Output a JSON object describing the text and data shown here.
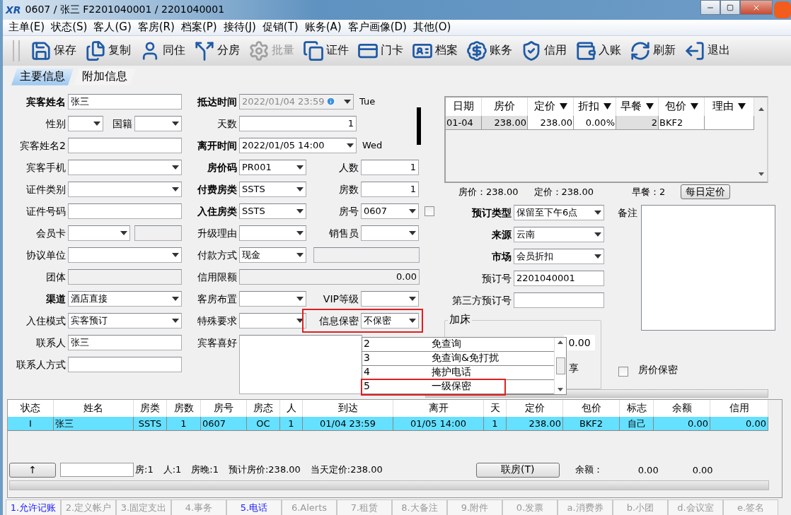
{
  "window": {
    "logo": "XR",
    "title": "0607 / 张三 F2201040001 / 2201040001"
  },
  "menu": [
    "主单(E)",
    "状态(S)",
    "客人(G)",
    "客房(R)",
    "档案(P)",
    "接待(J)",
    "促销(T)",
    "账务(A)",
    "客户画像(D)",
    "其他(O)"
  ],
  "toolbar": [
    {
      "label": "保存",
      "enabled": true
    },
    {
      "label": "复制",
      "enabled": true
    },
    {
      "label": "同住",
      "enabled": true
    },
    {
      "label": "分房",
      "enabled": true
    },
    {
      "label": "批量",
      "enabled": false
    },
    {
      "label": "证件",
      "enabled": true
    },
    {
      "label": "门卡",
      "enabled": true
    },
    {
      "label": "档案",
      "enabled": true
    },
    {
      "label": "账务",
      "enabled": true
    },
    {
      "label": "信用",
      "enabled": true
    },
    {
      "label": "入账",
      "enabled": true
    },
    {
      "label": "刷新",
      "enabled": true
    },
    {
      "label": "退出",
      "enabled": true
    }
  ],
  "tabs": [
    {
      "label": "主要信息",
      "selected": true
    },
    {
      "label": "附加信息",
      "selected": false
    }
  ],
  "guest_form": {
    "rows": [
      [
        {
          "label": "宾客姓名",
          "bold": true,
          "kind": "text",
          "value": "张三"
        },
        {
          "label": "抵达时间",
          "bold": true,
          "kind": "date",
          "value": "2022/01/04 23:59",
          "disabled": true
        },
        {
          "kind": "day",
          "value": "Tue"
        }
      ],
      [
        {
          "label": "性别",
          "bold": false,
          "kind": "select"
        },
        {
          "label": "国籍",
          "bold": false,
          "kind": "select"
        },
        {
          "label": "天数",
          "bold": false,
          "kind": "number",
          "value": "1"
        }
      ],
      [
        {
          "label": "宾客姓名2",
          "bold": false,
          "kind": "text"
        },
        {
          "label": "离开时间",
          "bold": true,
          "kind": "date",
          "value": "2022/01/05 14:00",
          "disabled": false
        },
        {
          "kind": "day",
          "value": "Wed"
        }
      ],
      [
        {
          "label": "宾客手机",
          "bold": false,
          "kind": "select"
        },
        {
          "label": "房价码",
          "bold": true,
          "kind": "select",
          "value": "PR001"
        },
        {
          "label": "人数",
          "bold": false,
          "kind": "number",
          "value": "1"
        }
      ],
      [
        {
          "label": "证件类别",
          "bold": false,
          "kind": "select"
        },
        {
          "label": "付费房类",
          "bold": true,
          "kind": "select",
          "value": "SSTS"
        },
        {
          "label": "房数",
          "bold": false,
          "kind": "number",
          "value": "1"
        }
      ],
      [
        {
          "label": "证件号码",
          "bold": false,
          "kind": "text"
        },
        {
          "label": "入住房类",
          "bold": true,
          "kind": "select",
          "value": "SSTS"
        },
        {
          "label": "房号",
          "bold": false,
          "kind": "select",
          "value": "0607"
        },
        {
          "kind": "checkbox",
          "checked": false
        }
      ],
      [
        {
          "label": "会员卡",
          "bold": false,
          "kind": "select"
        },
        {
          "kind": "readonly"
        },
        {
          "label": "升级理由",
          "bold": false,
          "kind": "select"
        },
        {
          "label": "销售员",
          "bold": false,
          "kind": "select"
        }
      ],
      [
        {
          "label": "协议单位",
          "bold": false,
          "kind": "select"
        },
        {
          "label": "付款方式",
          "bold": false,
          "kind": "select",
          "value": "现金"
        },
        {
          "kind": "readonly"
        }
      ],
      [
        {
          "label": "团体",
          "bold": false,
          "kind": "readonly"
        },
        {
          "label": "信用限额",
          "bold": false,
          "kind": "readonly",
          "value": "0.00"
        }
      ],
      [
        {
          "label": "渠道",
          "bold": true,
          "kind": "select",
          "value": "酒店直接"
        },
        {
          "label": "客房布置",
          "bold": false,
          "kind": "select"
        },
        {
          "label": "VIP等级",
          "bold": false,
          "kind": "select"
        }
      ],
      [
        {
          "label": "入住模式",
          "bold": false,
          "kind": "select",
          "value": "宾客预订"
        },
        {
          "label": "特殊要求",
          "bold": false,
          "kind": "select"
        },
        {
          "label": "信息保密",
          "bold": false,
          "kind": "select",
          "value": "不保密",
          "highlighted": true
        }
      ],
      [
        {
          "label": "联系人",
          "bold": false,
          "kind": "text",
          "value": "张三"
        },
        {
          "label": "宾客喜好",
          "bold": false,
          "kind": "textarea"
        }
      ],
      [
        {
          "label": "联系人方式",
          "bold": false,
          "kind": "text"
        }
      ]
    ]
  },
  "rate_grid": {
    "columns": [
      {
        "label": "日期",
        "menu": false
      },
      {
        "label": "房价",
        "menu": false
      },
      {
        "label": "定价",
        "menu": true
      },
      {
        "label": "折扣",
        "menu": true
      },
      {
        "label": "早餐",
        "menu": true
      },
      {
        "label": "包价",
        "menu": true
      },
      {
        "label": "理由",
        "menu": true
      }
    ],
    "rows": [
      [
        "01-04",
        "238.00",
        "238.00",
        "0.00%",
        "2",
        "BKF2"
      ]
    ]
  },
  "rate_summary": {
    "items": [
      "房价：238.00",
      "定价：238.00",
      "早餐：2"
    ],
    "button": "每日定价"
  },
  "booking_form": [
    {
      "label": "预订类型",
      "bold": true,
      "kind": "select",
      "value": "保留至下午6点"
    },
    {
      "label": "来源",
      "bold": true,
      "kind": "select",
      "value": "云南"
    },
    {
      "label": "市场",
      "bold": true,
      "kind": "select",
      "value": "会员折扣"
    },
    {
      "label": "预订号",
      "bold": false,
      "kind": "text",
      "value": "2201040001"
    },
    {
      "label": "第三方预订号",
      "bold": false,
      "kind": "text"
    }
  ],
  "remarks": {
    "label": "备注"
  },
  "extra_bed": {
    "title": "加床",
    "value": "0.00",
    "share_label": "享"
  },
  "rate_secret": {
    "label": "房价保密",
    "checked": false
  },
  "dropdown_list": {
    "items": [
      {
        "code": "2",
        "label": "免查询",
        "highlighted": false
      },
      {
        "code": "3",
        "label": "免查询&免打扰",
        "highlighted": false
      },
      {
        "code": "4",
        "label": "掩护电话",
        "highlighted": false
      },
      {
        "code": "5",
        "label": "一级保密",
        "highlighted": true
      }
    ]
  },
  "guest_table": {
    "columns": [
      "状态",
      "姓名",
      "房类",
      "房数",
      "房号",
      "房态",
      "人",
      "到达",
      "离开",
      "天",
      "定价",
      "包价",
      "标志",
      "余额",
      "信用"
    ],
    "rows": [
      {
        "selected": true,
        "cells": [
          "I",
          "张三",
          "SSTS",
          "1",
          "0607",
          "OC",
          "1",
          "01/04 23:59",
          "01/05 14:00",
          "1",
          "238.00",
          "BKF2",
          "自己",
          "0.00",
          "0.00"
        ]
      }
    ]
  },
  "guest_footer": {
    "up_button": "↑",
    "summary": [
      "房:1",
      "人:1",
      "房晚:1",
      "预计房价:238.00",
      "当天定价:238.00"
    ],
    "link_button": "联房(T)",
    "balance_label": "余额：",
    "balance": "0.00",
    "credit": "0.00"
  },
  "bottom_tabs": [
    {
      "label": "1.允许记账",
      "enabled": true
    },
    {
      "label": "2.定义帐户",
      "enabled": false
    },
    {
      "label": "3.固定支出",
      "enabled": false
    },
    {
      "label": "4.事务",
      "enabled": false
    },
    {
      "label": "5.电话",
      "enabled": true
    },
    {
      "label": "6.Alerts",
      "enabled": false
    },
    {
      "label": "7.租赁",
      "enabled": false
    },
    {
      "label": "8.大备注",
      "enabled": false
    },
    {
      "label": "9.附件",
      "enabled": false
    },
    {
      "label": "0.发票",
      "enabled": false
    },
    {
      "label": "a.消费券",
      "enabled": false
    },
    {
      "label": "b.小团",
      "enabled": false
    },
    {
      "label": "d.会议室",
      "enabled": false
    },
    {
      "label": "e.签名",
      "enabled": false
    }
  ]
}
